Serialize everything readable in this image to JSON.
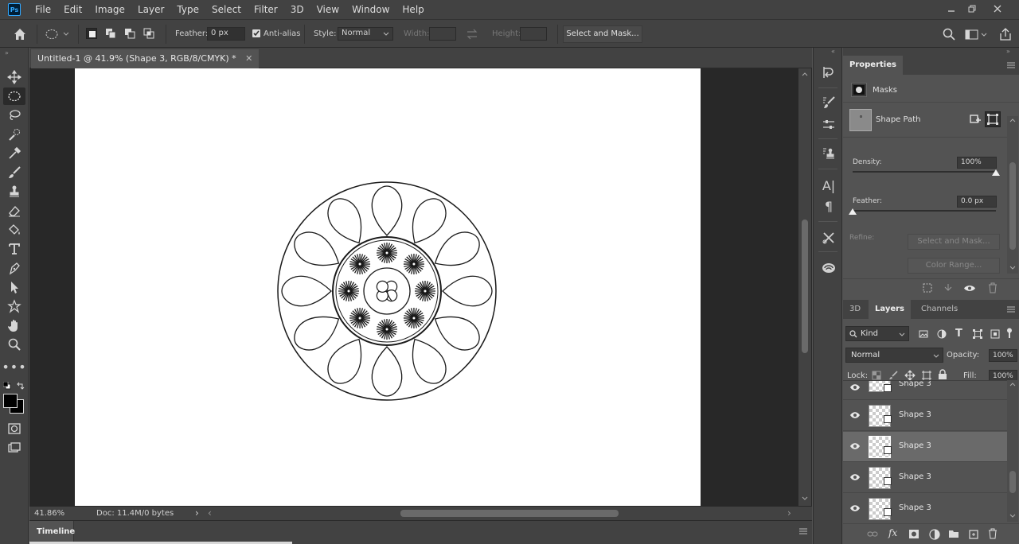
{
  "app": {
    "logo": "Ps"
  },
  "menu": [
    "File",
    "Edit",
    "Image",
    "Layer",
    "Type",
    "Select",
    "Filter",
    "3D",
    "View",
    "Window",
    "Help"
  ],
  "options_bar": {
    "feather_label": "Feather:",
    "feather_value": "0 px",
    "antialias_label": "Anti-alias",
    "antialias_checked": true,
    "style_label": "Style:",
    "style_value": "Normal",
    "width_label": "Width:",
    "height_label": "Height:",
    "select_mask_button": "Select and Mask..."
  },
  "document": {
    "tab_title": "Untitled-1 @ 41.9% (Shape 3, RGB/8/CMYK) *",
    "zoom": "41.86%",
    "doc_info": "Doc: 11.4M/0 bytes"
  },
  "timeline": {
    "label": "Timeline"
  },
  "properties": {
    "tab": "Properties",
    "masks_label": "Masks",
    "shape_path_label": "Shape Path",
    "density_label": "Density:",
    "density_value": "100%",
    "density_fraction": 1.0,
    "feather_label": "Feather:",
    "feather_value": "0.0 px",
    "feather_fraction": 0.0,
    "refine_label": "Refine:",
    "select_mask_button": "Select and Mask...",
    "color_range_button": "Color Range..."
  },
  "layers_panel": {
    "tabs": [
      "3D",
      "Layers",
      "Channels"
    ],
    "active_tab": "Layers",
    "kind_filter": "Kind",
    "blend_mode": "Normal",
    "opacity_label": "Opacity:",
    "opacity_value": "100%",
    "lock_label": "Lock:",
    "fill_label": "Fill:",
    "fill_value": "100%",
    "partial_layer_name": "Shape 3",
    "layers": [
      {
        "name": "Shape 3",
        "visible": true,
        "selected": false
      },
      {
        "name": "Shape 3",
        "visible": true,
        "selected": true
      },
      {
        "name": "Shape 3",
        "visible": true,
        "selected": false
      },
      {
        "name": "Shape 3",
        "visible": true,
        "selected": false
      }
    ]
  },
  "colors": {
    "ui_dark": "#424242",
    "ui_mid": "#535353",
    "canvas": "#ffffff",
    "pasteboard": "#282828",
    "accent_blue": "#31a8ff"
  }
}
